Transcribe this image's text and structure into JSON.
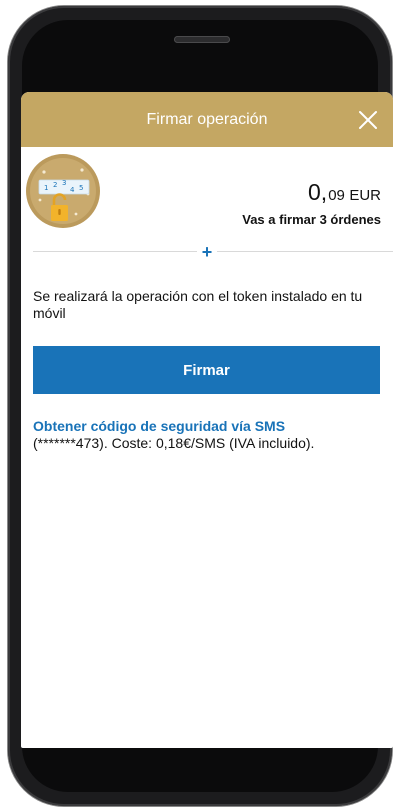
{
  "header": {
    "title": "Firmar operación",
    "close_icon": "close-icon",
    "background_color": "#c4a763"
  },
  "token_badge": {
    "icon": "token-lock-icon",
    "digits": [
      "1",
      "2",
      "3",
      "4",
      "5"
    ]
  },
  "amount": {
    "integer": "0,",
    "decimals": "09",
    "currency": "EUR"
  },
  "orders_text": "Vas a firmar 3 órdenes",
  "expand_icon": "+",
  "info_text": "Se realizará la operación con el token instalado en tu móvil",
  "sign_button": {
    "label": "Firmar",
    "color": "#1973b8"
  },
  "sms": {
    "link_label": "Obtener código de seguridad vía SMS",
    "detail": "(*******473). Coste: 0,18€/SMS (IVA incluido)."
  },
  "colors": {
    "accent": "#1973b8",
    "gold": "#c4a763",
    "text": "#121212"
  }
}
